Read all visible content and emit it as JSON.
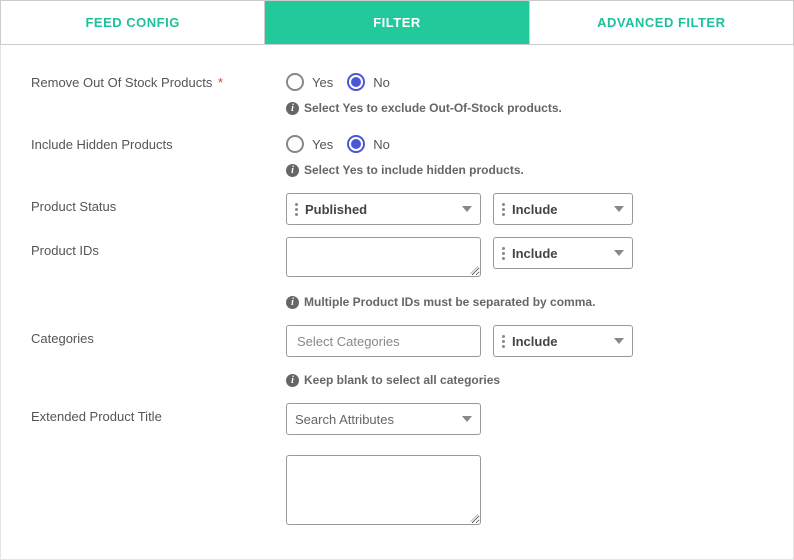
{
  "tabs": {
    "feed_config": "FEED CONFIG",
    "filter": "FILTER",
    "advanced_filter": "ADVANCED FILTER",
    "active": "filter"
  },
  "fields": {
    "remove_oos": {
      "label": "Remove Out Of Stock Products",
      "required_marker": "*",
      "yes": "Yes",
      "no": "No",
      "selected": "no",
      "hint": "Select Yes to exclude Out-Of-Stock products."
    },
    "include_hidden": {
      "label": "Include Hidden Products",
      "yes": "Yes",
      "no": "No",
      "selected": "no",
      "hint": "Select Yes to include hidden products."
    },
    "product_status": {
      "label": "Product Status",
      "value": "Published",
      "mode": "Include"
    },
    "product_ids": {
      "label": "Product IDs",
      "value": "",
      "mode": "Include",
      "hint": "Multiple Product IDs must be separated by comma."
    },
    "categories": {
      "label": "Categories",
      "placeholder": "Select Categories",
      "mode": "Include",
      "hint": "Keep blank to select all categories"
    },
    "extended_title": {
      "label": "Extended Product Title",
      "attributes_placeholder": "Search Attributes",
      "value": ""
    }
  },
  "info_glyph": "i"
}
